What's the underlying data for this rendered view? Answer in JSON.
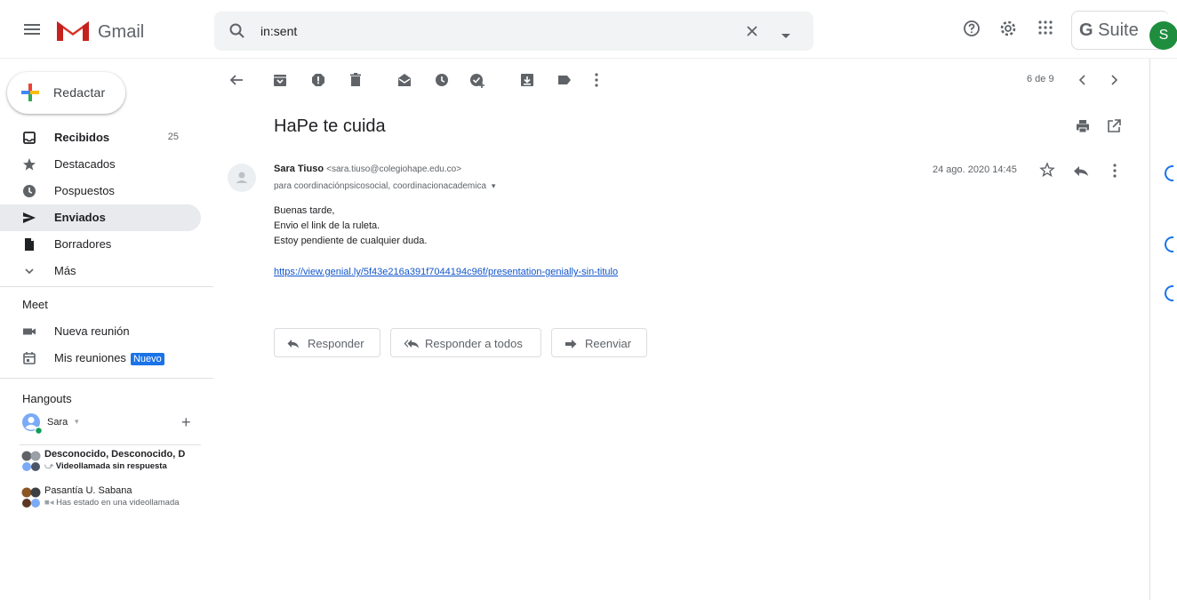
{
  "header": {
    "app_name": "Gmail",
    "search_value": "in:sent",
    "gsuite_label": "Suite",
    "gsuite_g": "G",
    "avatar_initial": "S"
  },
  "sidebar": {
    "compose_label": "Redactar",
    "items": [
      {
        "label": "Recibidos",
        "count": "25",
        "bold": true
      },
      {
        "label": "Destacados"
      },
      {
        "label": "Pospuestos"
      },
      {
        "label": "Enviados",
        "active": true
      },
      {
        "label": "Borradores"
      },
      {
        "label": "Más"
      }
    ],
    "meet": {
      "title": "Meet",
      "new_meeting": "Nueva reunión",
      "my_meetings": "Mis reuniones",
      "badge": "Nuevo"
    },
    "hangouts": {
      "title": "Hangouts",
      "user": "Sara",
      "conversations": [
        {
          "name": "Desconocido, Desconocido, D",
          "status": "Videollamada sin respuesta"
        },
        {
          "name": "Pasantía U. Sabana",
          "status": "Has estado en una videollamada"
        }
      ]
    }
  },
  "toolbar": {
    "pager": "6 de 9"
  },
  "message": {
    "subject": "HaPe te cuida",
    "sender_name": "Sara Tiuso",
    "sender_email": "<sara.tiuso@colegiohape.edu.co>",
    "recipients": "para coordinaciónpsicosocial, coordinacionacademica",
    "date": "24 ago. 2020 14:45",
    "body_lines": [
      "Buenas tarde,",
      "Envio el link de la ruleta.",
      "Estoy pendiente de cualquier duda."
    ],
    "link": "https://view.genial.ly/5f43e216a391f7044194c96f/presentation-genially-sin-titulo"
  },
  "actions": {
    "reply": "Responder",
    "reply_all": "Responder a todos",
    "forward": "Reenviar"
  },
  "colors": {
    "accent": "#1a73e8",
    "active_nav": "#e8eaed",
    "link": "#1155cc"
  }
}
